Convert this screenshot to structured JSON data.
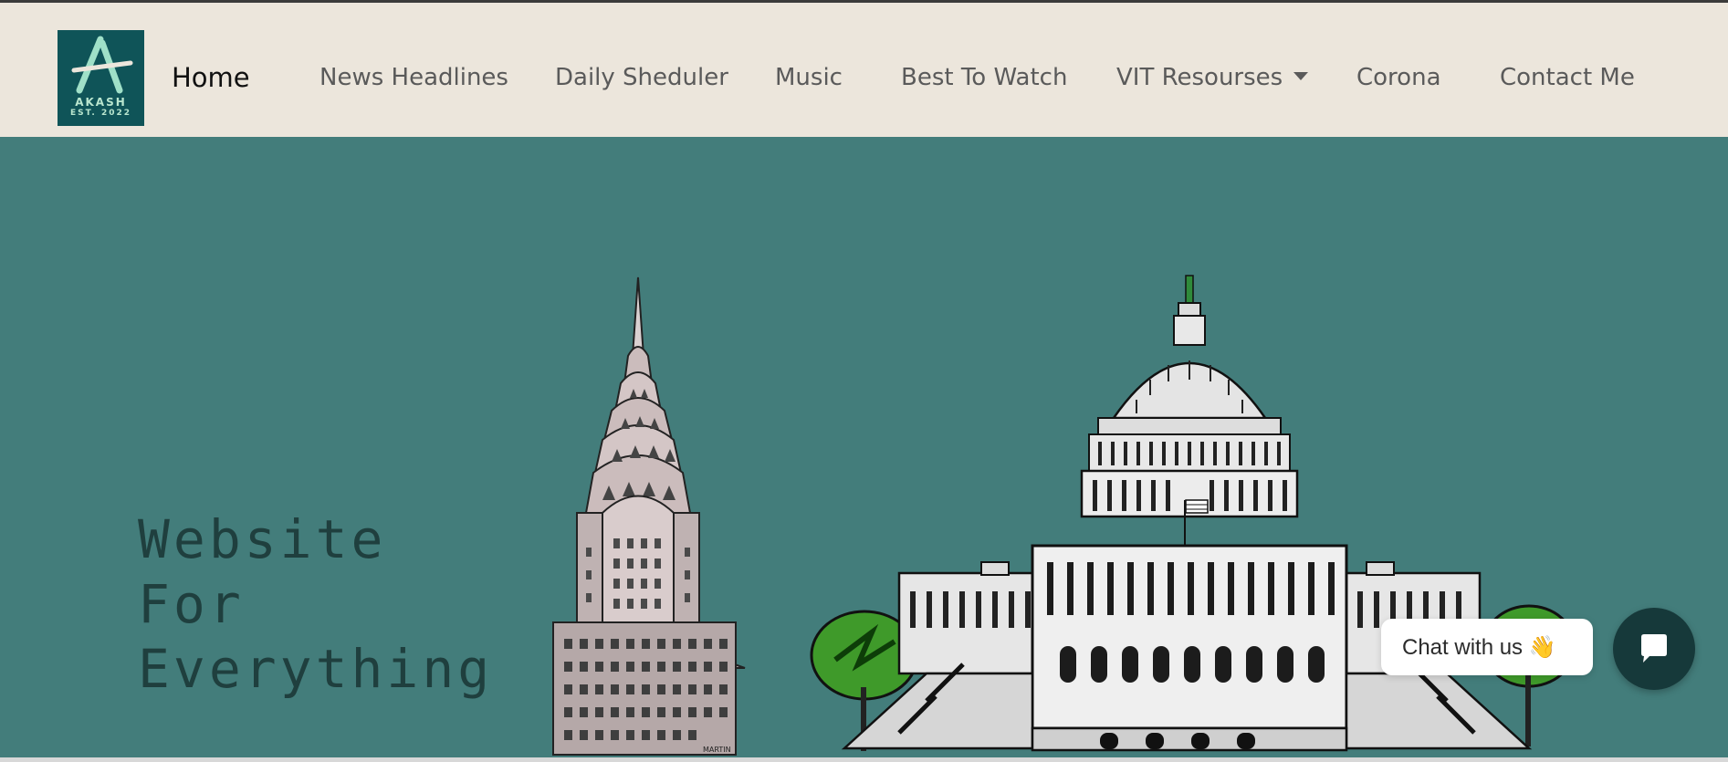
{
  "navbar": {
    "logo": {
      "word": "AKASH",
      "est": "EST. 2022"
    },
    "items": [
      {
        "label": "Home",
        "active": true
      },
      {
        "label": "News Headlines"
      },
      {
        "label": "Daily Sheduler"
      },
      {
        "label": "Music"
      },
      {
        "label": "Best To Watch"
      },
      {
        "label": "VIT Resourses",
        "dropdown": true
      },
      {
        "label": "Corona"
      },
      {
        "label": "Contact Me"
      }
    ]
  },
  "hero": {
    "title_lines": [
      "Website",
      "For",
      "Everything"
    ],
    "illustrations": [
      "chrysler-building",
      "us-capitol-building"
    ],
    "signature": "MARTIN"
  },
  "chat": {
    "bubble_text": "Chat with us",
    "emoji": "👋",
    "button_icon": "chat-icon"
  },
  "colors": {
    "hero_bg": "#437d7b",
    "navbar_bg": "#ece6dc",
    "logo_bg": "#0f5458",
    "chat_button": "#16393a"
  }
}
